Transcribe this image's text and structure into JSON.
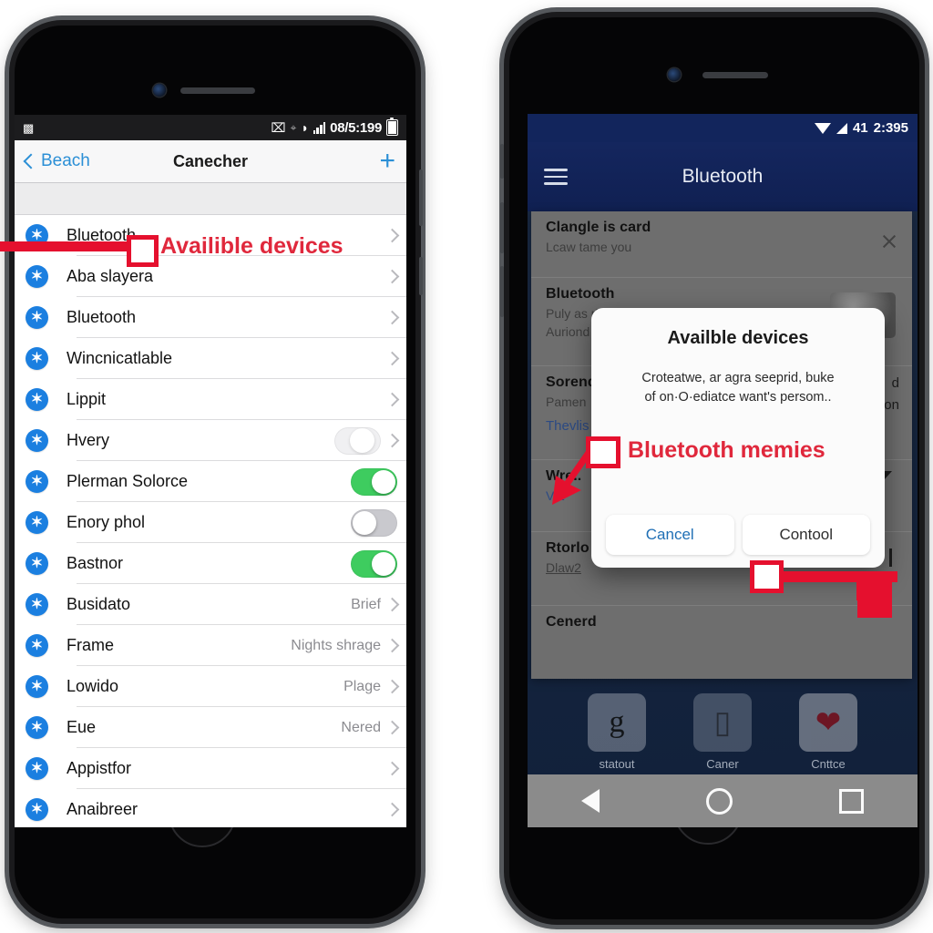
{
  "left_phone": {
    "status_bar": {
      "notification_icon": "camera-icon",
      "bluetooth_off_icon": "bluetooth-disabled-icon",
      "location_icon": "location-icon",
      "wifi_icon": "wifi-icon",
      "signal_icon": "signal-icon",
      "clock": "08/5:199",
      "battery_icon": "battery-icon"
    },
    "nav": {
      "back_label": "Beach",
      "title": "Canecher",
      "add_label": "+"
    },
    "list": [
      {
        "label": "Bluetooth",
        "detail": "",
        "accessory": "chevron"
      },
      {
        "label": "Aba slayera",
        "detail": "",
        "accessory": "chevron"
      },
      {
        "label": "Bluetooth",
        "detail": "",
        "accessory": "chevron"
      },
      {
        "label": "Wincnicatlable",
        "detail": "",
        "accessory": "chevron"
      },
      {
        "label": "Lippit",
        "detail": "",
        "accessory": "chevron"
      },
      {
        "label": "Hvery",
        "detail": "",
        "accessory": "toggle-ghost-chevron"
      },
      {
        "label": "Plerman Solorce",
        "detail": "",
        "accessory": "toggle-on"
      },
      {
        "label": "Enory phol",
        "detail": "",
        "accessory": "toggle-off"
      },
      {
        "label": "Bastnor",
        "detail": "",
        "accessory": "toggle-on"
      },
      {
        "label": "Busidato",
        "detail": "Brief",
        "accessory": "chevron"
      },
      {
        "label": "Frame",
        "detail": "Nights shrage",
        "accessory": "chevron"
      },
      {
        "label": "Lowido",
        "detail": "Plage",
        "accessory": "chevron"
      },
      {
        "label": "Eue",
        "detail": "Nered",
        "accessory": "chevron"
      },
      {
        "label": "Appistfor",
        "detail": "",
        "accessory": "chevron"
      },
      {
        "label": "Anaibreer",
        "detail": "",
        "accessory": "chevron"
      }
    ],
    "annotation": {
      "text": "Availible devices",
      "color": "#e0283c"
    }
  },
  "right_phone": {
    "status_bar": {
      "wifi_icon": "wifi-icon",
      "signal_icon": "signal-icon",
      "battery_level": "41",
      "clock": "2:395"
    },
    "app_bar": {
      "menu_icon": "hamburger-menu-icon",
      "title": "Bluetooth"
    },
    "background_card": {
      "close_icon": "close-icon",
      "sections": [
        {
          "title": "Clangle is card",
          "subtitle": "Lcaw tame you"
        },
        {
          "title": "Bluetooth",
          "subtitle": "Puly as rlgadone",
          "subtitle2": "Auriond"
        },
        {
          "title": "Sorend",
          "subtitle": "Pamen",
          "link": "Thevlis"
        },
        {
          "title": "Wre..",
          "subtitle": "Vot",
          "right_accessory": "caret-down-solid"
        },
        {
          "title": "Rtorlo",
          "subtitle": "Dlaw2",
          "right_accessory": "chevron-down"
        },
        {
          "title": "Cenerd",
          "subtitle": ""
        }
      ],
      "right_fragments": [
        "d",
        "ation"
      ]
    },
    "dialog": {
      "title": "Availble devices",
      "body_line1": "Croteatwe, ar agra seeprid, buke",
      "body_line2": "of on·O·ediatce want's persom..",
      "cancel_label": "Cancel",
      "confirm_label": "Contool"
    },
    "home_screen": {
      "apps": [
        {
          "label": "statout",
          "icon": "google-icon",
          "glyph": "g"
        },
        {
          "label": "Caner",
          "icon": "camera-icon",
          "glyph": "▯"
        },
        {
          "label": "Cnttce",
          "icon": "heart-icon",
          "glyph": "❤"
        }
      ],
      "page_dots": 3,
      "dock": [
        {
          "icon": "phone-icon",
          "glyph": "✆",
          "color": "#1c5a22"
        },
        {
          "icon": "message-icon",
          "glyph": "●",
          "color": "#1d6b2c"
        },
        {
          "icon": "compass-icon",
          "glyph": "◉",
          "color": "#1c3f78"
        },
        {
          "icon": "chat-icon",
          "glyph": "●",
          "color": "#1d6b2c"
        },
        {
          "icon": "lock-icon",
          "glyph": "▣",
          "color": "#23262c"
        }
      ],
      "nav_bar": {
        "back": "back-icon",
        "home": "home-icon",
        "recents": "recents-icon"
      }
    },
    "annotation": {
      "text": "Bluetooth memies",
      "color": "#e0283c"
    }
  }
}
